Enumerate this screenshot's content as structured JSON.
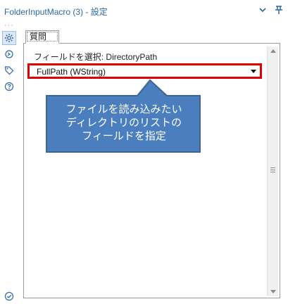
{
  "window": {
    "title": "FolderInputMacro (3) - 設定"
  },
  "sidebar": {
    "icons": [
      "gear-icon",
      "arrow-cycle-icon",
      "tag-icon",
      "help-icon"
    ],
    "bottom_icon": "check-circle-icon",
    "accent_color": "#2b67a6"
  },
  "tab": {
    "label": "質問"
  },
  "field": {
    "label": "フィールドを選択: DirectoryPath",
    "selected_value": "FullPath (WString)",
    "highlight_color": "#e00000"
  },
  "callout": {
    "lines": [
      "ファイルを読み込みたい",
      "ディレクトリのリストの",
      "フィールドを指定"
    ],
    "fill_color": "#4a7ebf",
    "border_color": "#3d6592"
  }
}
